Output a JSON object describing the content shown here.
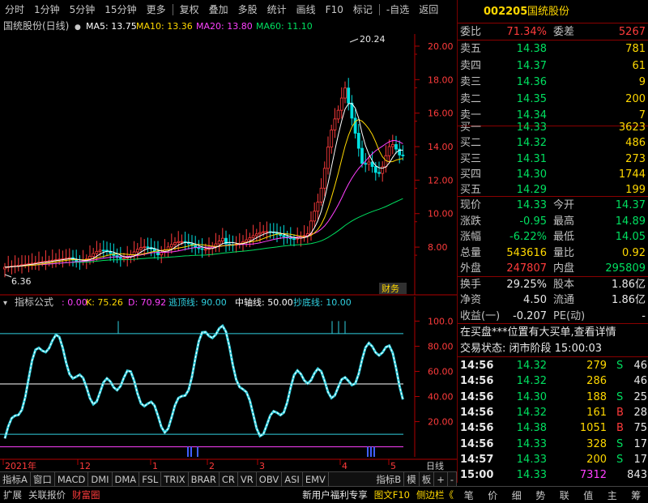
{
  "toolbar": {
    "items": [
      "分时",
      "1分钟",
      "5分钟",
      "15分钟",
      "更多",
      "复权",
      "叠加",
      "多股",
      "统计",
      "画线",
      "F10",
      "标记",
      "-自选",
      "返回"
    ]
  },
  "chart": {
    "title": "国统股份(日线)",
    "ma": [
      {
        "label": "MA5: 13.75",
        "color": "#ffffff"
      },
      {
        "label": "MA10: 13.36",
        "color": "#ffd800"
      },
      {
        "label": "MA20: 13.80",
        "color": "#ff40ff"
      },
      {
        "label": "MA60: 11.10",
        "color": "#00e060"
      }
    ],
    "high_label": "20.24",
    "low_label": "6.36",
    "y_ticks": [
      "20.00",
      "18.00",
      "16.00",
      "14.00",
      "12.00",
      "10.00",
      "8.00"
    ],
    "badge": "财务",
    "indicator": {
      "name": "指标公式",
      "values": [
        {
          "text": ": 0.00",
          "color": "#ff40ff"
        },
        {
          "text": "K: 75.26",
          "color": "#ffd800"
        },
        {
          "text": "D: 70.92",
          "color": "#ff40ff"
        },
        {
          "text": "逃顶线: 90.00",
          "color": "#30d0e0"
        },
        {
          "text": "中轴线: 50.00",
          "color": "#ffffff"
        },
        {
          "text": "抄底线: 10.00",
          "color": "#30d0e0"
        }
      ],
      "y_ticks": [
        "100.0",
        "80.00",
        "60.00",
        "40.00",
        "20.00"
      ]
    },
    "date_axis": [
      "2021年",
      "12",
      "1",
      "2",
      "3",
      "4",
      "5"
    ],
    "period_label": "日线"
  },
  "tabs": [
    "指标A",
    "窗口",
    "MACD",
    "DMI",
    "DMA",
    "FSL",
    "TRIX",
    "BRAR",
    "CR",
    "VR",
    "OBV",
    "ASI",
    "EMV",
    "指标B",
    "模",
    "板",
    "+",
    "-"
  ],
  "status": {
    "left": [
      "扩展",
      "关联报价",
      "财富圈"
    ],
    "news": "新用户福利专享",
    "f10": "图文F10",
    "side": "侧边栏《"
  },
  "quote": {
    "code": "002205",
    "name": "国统股份",
    "weibi_label": "委比",
    "weibi_value": "71.34%",
    "weicha_label": "委差",
    "weicha_value": "5267",
    "sells": [
      {
        "label": "卖五",
        "price": "14.38",
        "vol": "781"
      },
      {
        "label": "卖四",
        "price": "14.37",
        "vol": "61"
      },
      {
        "label": "卖三",
        "price": "14.36",
        "vol": "9"
      },
      {
        "label": "卖二",
        "price": "14.35",
        "vol": "200"
      },
      {
        "label": "卖一",
        "price": "14.34",
        "vol": "7"
      }
    ],
    "buys": [
      {
        "label": "买一",
        "price": "14.33",
        "vol": "3623"
      },
      {
        "label": "买二",
        "price": "14.32",
        "vol": "486"
      },
      {
        "label": "买三",
        "price": "14.31",
        "vol": "273"
      },
      {
        "label": "买四",
        "price": "14.30",
        "vol": "1744"
      },
      {
        "label": "买五",
        "price": "14.29",
        "vol": "199"
      }
    ],
    "stats": [
      {
        "l1": "现价",
        "v1": "14.33",
        "c1": "green",
        "l2": "今开",
        "v2": "14.37",
        "c2": "green"
      },
      {
        "l1": "涨跌",
        "v1": "-0.95",
        "c1": "green",
        "l2": "最高",
        "v2": "14.89",
        "c2": "green"
      },
      {
        "l1": "涨幅",
        "v1": "-6.22%",
        "c1": "green",
        "l2": "最低",
        "v2": "14.05",
        "c2": "green"
      },
      {
        "l1": "总量",
        "v1": "543616",
        "c1": "yellow",
        "l2": "量比",
        "v2": "0.92",
        "c2": "yellow"
      },
      {
        "l1": "外盘",
        "v1": "247807",
        "c1": "red",
        "l2": "内盘",
        "v2": "295809",
        "c2": "green"
      }
    ],
    "stats2": [
      {
        "l1": "换手",
        "v1": "29.25%",
        "l2": "股本",
        "v2": "1.86亿"
      },
      {
        "l1": "净资",
        "v1": "4.50",
        "l2": "流通",
        "v2": "1.86亿"
      },
      {
        "l1": "收益(一)",
        "v1": "-0.207",
        "l2": "PE(动)",
        "v2": "-"
      }
    ],
    "notice": "在买盘***位置有大买单,查看详情",
    "trade_status": "交易状态: 闭市阶段 15:00:03",
    "ticks": [
      {
        "t": "14:56",
        "p": "14.32",
        "v": "279",
        "f": "S",
        "n": "46"
      },
      {
        "t": "14:56",
        "p": "14.32",
        "v": "286",
        "f": "",
        "n": "46"
      },
      {
        "t": "14:56",
        "p": "14.30",
        "v": "188",
        "f": "S",
        "n": "25"
      },
      {
        "t": "14:56",
        "p": "14.32",
        "v": "161",
        "f": "B",
        "n": "28"
      },
      {
        "t": "14:56",
        "p": "14.38",
        "v": "1051",
        "f": "B",
        "n": "75"
      },
      {
        "t": "14:56",
        "p": "14.33",
        "v": "328",
        "f": "S",
        "n": "17"
      },
      {
        "t": "14:57",
        "p": "14.33",
        "v": "200",
        "f": "S",
        "n": "17"
      },
      {
        "t": "15:00",
        "p": "14.33",
        "v": "7312",
        "f": "",
        "n": "843"
      }
    ]
  },
  "quotebar": [
    "笔",
    "价",
    "细",
    "势",
    "联",
    "值",
    "主",
    "筹"
  ]
}
